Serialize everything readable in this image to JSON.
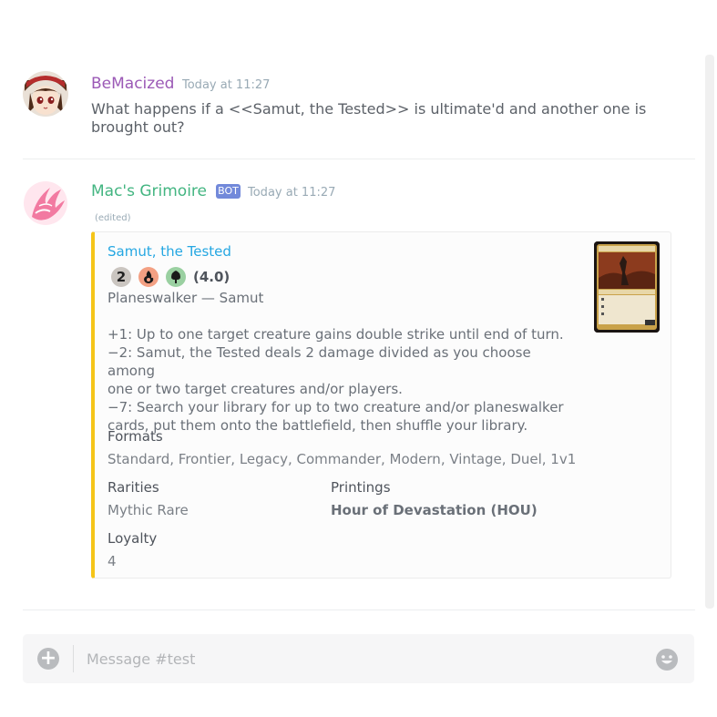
{
  "messages": [
    {
      "username": "BeMacized",
      "username_color": "#9b59b6",
      "timestamp": "Today at 11:27",
      "text_line1": "What happens if a <<Samut, the Tested>> is ultimate'd and another one is",
      "text_line2": "brought out?"
    },
    {
      "username": "Mac's Grimoire",
      "username_color": "#43b581",
      "bot_tag": "BOT",
      "timestamp": "Today at 11:27",
      "edited": "(edited)"
    }
  ],
  "embed": {
    "accent_color": "#f5c518",
    "title": "Samut, the Tested",
    "mana": [
      "2",
      "red-mana-icon",
      "green-mana-icon"
    ],
    "mana_2": "2",
    "cmc": "(4.0)",
    "type_line": "Planeswalker — Samut",
    "abilities": [
      "+1: Up to one target creature gains double strike until end of turn.",
      "−2: Samut, the Tested deals 2 damage divided as you choose among",
      "one or two target creatures and/or players.",
      "−7: Search your library for up to two creature and/or planeswalker",
      "cards, put them onto the battlefield, then shuffle your library."
    ],
    "fields": {
      "formats_name": "Formats",
      "formats_value": "Standard, Frontier, Legacy, Commander, Modern, Vintage, Duel, 1v1",
      "rarities_name": "Rarities",
      "rarities_value": "Mythic Rare",
      "printings_name": "Printings",
      "printings_value": "Hour of Devastation (HOU)",
      "loyalty_name": "Loyalty",
      "loyalty_value": "4"
    }
  },
  "composer": {
    "placeholder": "Message #test"
  }
}
